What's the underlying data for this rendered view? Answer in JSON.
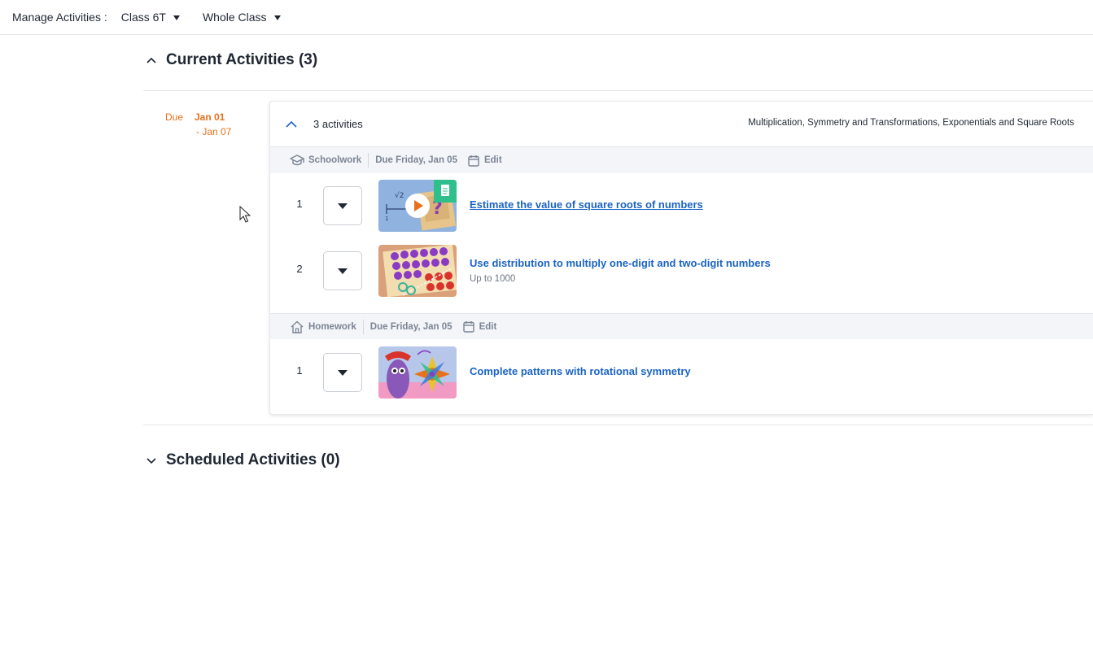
{
  "topbar": {
    "label": "Manage Activities :",
    "class_select": "Class 6T",
    "group_select": "Whole Class"
  },
  "current": {
    "title": "Current Activities (3)",
    "expanded": true
  },
  "scheduled": {
    "title": "Scheduled Activities (0)",
    "expanded": false
  },
  "due": {
    "label": "Due",
    "start": "Jan 01",
    "end": "- Jan 07"
  },
  "card": {
    "count_label": "3 activities",
    "topics": "Multiplication, Symmetry and Transformations, Exponentials and Square Roots"
  },
  "groups": [
    {
      "type": "Schoolwork",
      "due": "Due Friday, Jan 05",
      "edit": "Edit",
      "activities": [
        {
          "num": "1",
          "title": "Estimate the value of square roots of numbers",
          "subtitle": ""
        },
        {
          "num": "2",
          "title": "Use distribution to multiply one-digit and two-digit numbers",
          "subtitle": "Up to 1000"
        }
      ]
    },
    {
      "type": "Homework",
      "due": "Due Friday, Jan 05",
      "edit": "Edit",
      "activities": [
        {
          "num": "1",
          "title": "Complete patterns with rotational symmetry",
          "subtitle": ""
        }
      ]
    }
  ],
  "colors": {
    "accent_orange": "#e8711c",
    "link_blue": "#1a64c4",
    "text_dark": "#1f2733",
    "muted": "#7b8594",
    "group_bg": "#f3f5f8"
  },
  "icons": {
    "schoolwork": "graduation-cap-icon",
    "homework": "house-icon",
    "calendar": "calendar-icon"
  }
}
